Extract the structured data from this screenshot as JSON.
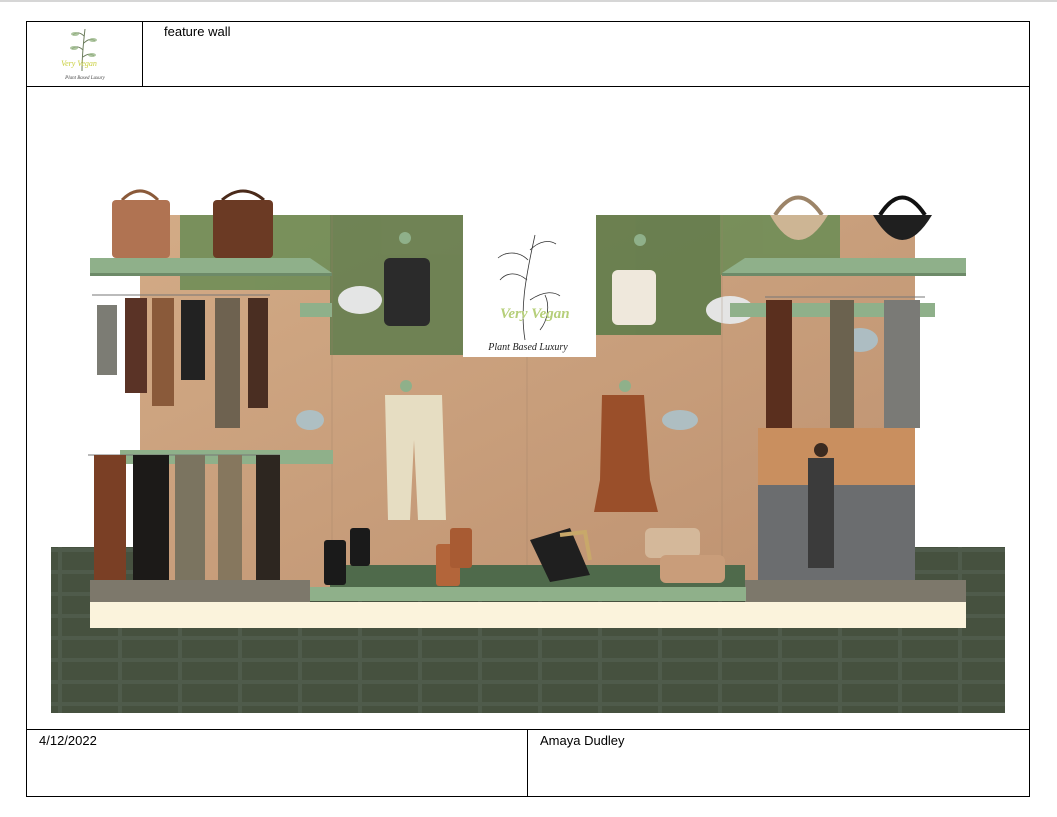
{
  "header": {
    "title": "feature wall",
    "logo_text_primary": "Very Vegan",
    "logo_text_secondary": "Plant Based Luxury"
  },
  "signage": {
    "brand_primary": "Very Vegan",
    "brand_secondary": "Plant Based Luxury"
  },
  "footer": {
    "date": "4/12/2022",
    "author": "Amaya Dudley"
  },
  "colors": {
    "shelf_green": "#8fb08a",
    "floor_dark": "#4a5646",
    "platform_cream": "#fbf3dc",
    "platform_green": "#6f8e6c",
    "wood": "#c9a07d"
  }
}
